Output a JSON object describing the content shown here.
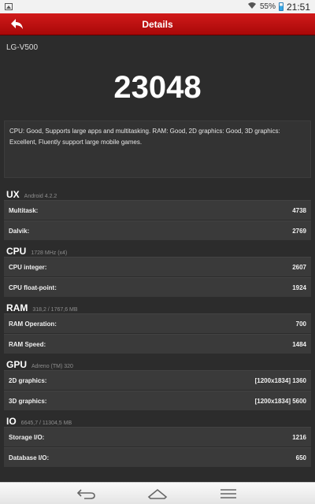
{
  "status_bar": {
    "battery": "55%",
    "time": "21:51"
  },
  "header": {
    "title": "Details"
  },
  "device": "LG-V500",
  "score": "23048",
  "summary": "CPU: Good, Supports large apps and multitasking. RAM: Good, 2D graphics: Good, 3D graphics: Excellent, Fluently support large mobile games.",
  "sections": {
    "ux": {
      "name": "UX",
      "info": "Android 4.2.2",
      "rows": [
        {
          "label": "Multitask:",
          "value": "4738"
        },
        {
          "label": "Dalvik:",
          "value": "2769"
        }
      ]
    },
    "cpu": {
      "name": "CPU",
      "info": "1728 MHz (x4)",
      "rows": [
        {
          "label": "CPU integer:",
          "value": "2607"
        },
        {
          "label": "CPU float-point:",
          "value": "1924"
        }
      ]
    },
    "ram": {
      "name": "RAM",
      "info": "318,2 / 1767,6 MB",
      "rows": [
        {
          "label": "RAM Operation:",
          "value": "700"
        },
        {
          "label": "RAM Speed:",
          "value": "1484"
        }
      ]
    },
    "gpu": {
      "name": "GPU",
      "info": "Adreno (TM) 320",
      "rows": [
        {
          "label": "2D graphics:",
          "value": "[1200x1834] 1360"
        },
        {
          "label": "3D graphics:",
          "value": "[1200x1834] 5600"
        }
      ]
    },
    "io": {
      "name": "IO",
      "info": "6645,7 / 11304,5 MB",
      "rows": [
        {
          "label": "Storage I/O:",
          "value": "1216"
        },
        {
          "label": "Database I/O:",
          "value": "650"
        }
      ]
    }
  },
  "icons": {
    "back": "back-arrow-icon",
    "nav_back": "nav-back-icon",
    "nav_home": "home-icon",
    "nav_menu": "menu-icon"
  },
  "colors": {
    "header_red": "#c01010",
    "background": "#2c2c2c",
    "row_bg": "#3a3a3a"
  }
}
